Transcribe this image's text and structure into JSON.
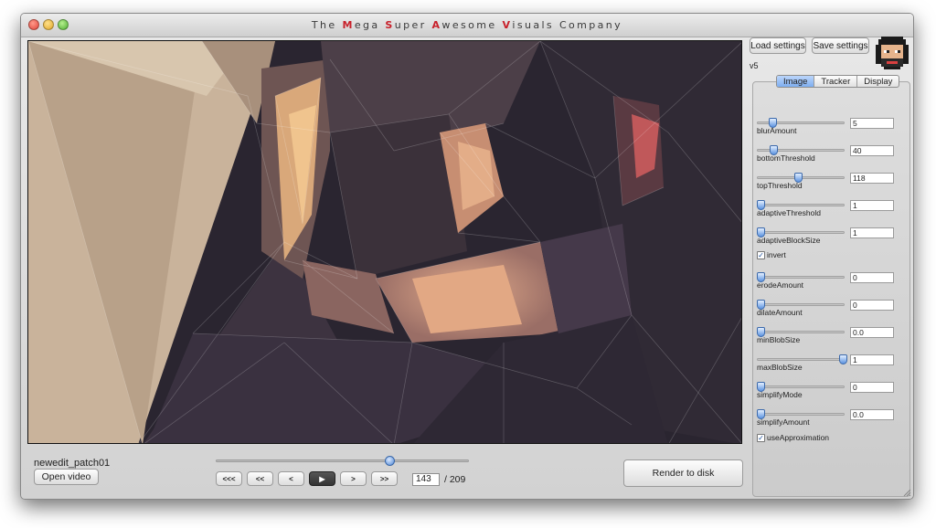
{
  "window": {
    "title_parts": [
      {
        "text": "The ",
        "highlight": false
      },
      {
        "text": "M",
        "highlight": true
      },
      {
        "text": "ega ",
        "highlight": false
      },
      {
        "text": "S",
        "highlight": true
      },
      {
        "text": "uper ",
        "highlight": false
      },
      {
        "text": "A",
        "highlight": true
      },
      {
        "text": "wesome ",
        "highlight": false
      },
      {
        "text": "V",
        "highlight": true
      },
      {
        "text": "isuals Company",
        "highlight": false
      }
    ],
    "highlight_color": "#c8202a"
  },
  "player": {
    "filename": "newedit_patch01",
    "open_video_label": "Open video",
    "scrubber_fraction": 0.684,
    "buttons": {
      "first": "<<<",
      "prev_fast": "<<",
      "prev": "<",
      "play": "▶",
      "next": ">",
      "next_fast": ">>"
    },
    "current_frame": "143",
    "total_frames": "/ 209",
    "render_label": "Render to disk"
  },
  "panel": {
    "load_label": "Load settings",
    "save_label": "Save settings",
    "version": "v5",
    "tabs": [
      "Image",
      "Tracker",
      "Display"
    ],
    "active_tab": "Image",
    "params": [
      {
        "label": "blurAmount",
        "value": "5",
        "level": 0.14
      },
      {
        "label": "bottomThreshold",
        "value": "40",
        "level": 0.16
      },
      {
        "label": "topThreshold",
        "value": "118",
        "level": 0.46
      },
      {
        "label": "adaptiveThreshold",
        "value": "1",
        "level": 0.0
      },
      {
        "label": "adaptiveBlockSize",
        "value": "1",
        "level": 0.0
      },
      {
        "label": "erodeAmount",
        "value": "0",
        "level": 0.0
      },
      {
        "label": "dilateAmount",
        "value": "0",
        "level": 0.0
      },
      {
        "label": "minBlobSize",
        "value": "0.0",
        "level": 0.0
      },
      {
        "label": "maxBlobSize",
        "value": "1",
        "level": 1.0
      },
      {
        "label": "simplifyMode",
        "value": "0",
        "level": 0.0
      },
      {
        "label": "simplifyAmount",
        "value": "0.0",
        "level": 0.0
      }
    ],
    "checks": [
      {
        "label": "invert",
        "checked": true
      },
      {
        "label": "useApproximation",
        "checked": true
      }
    ]
  }
}
